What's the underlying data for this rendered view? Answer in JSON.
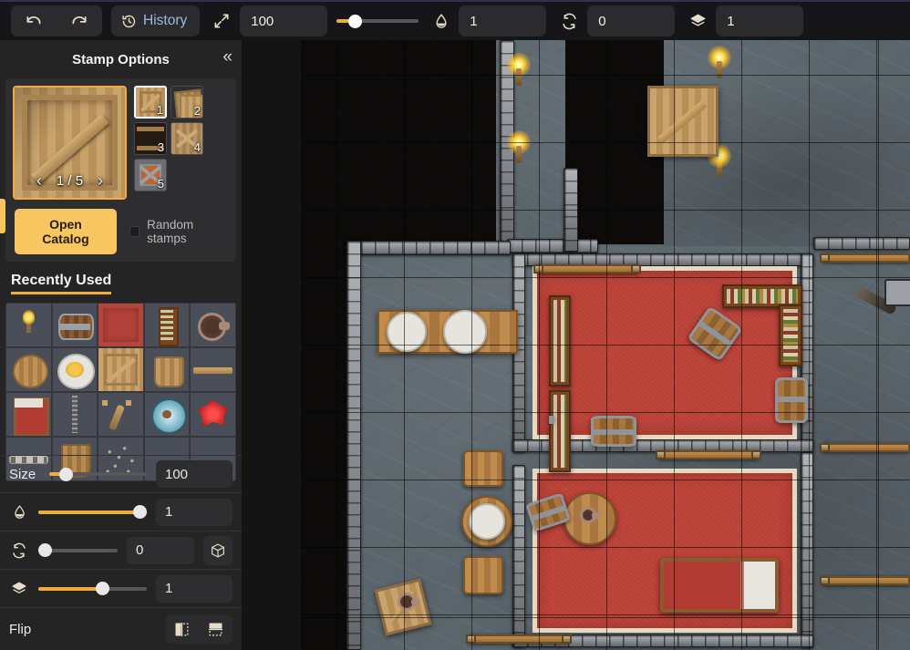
{
  "toolbar": {
    "undo": {
      "name": "undo",
      "icon": "undo-icon"
    },
    "redo": {
      "name": "redo",
      "icon": "redo-icon"
    },
    "history_label": "History",
    "size": {
      "icon": "resize-diagonal-icon",
      "value": "100",
      "slider_percent": 12
    },
    "opacity": {
      "icon": "droplet-icon",
      "value": "1"
    },
    "rotation": {
      "icon": "rotate-icon",
      "value": "0"
    },
    "layer": {
      "icon": "layers-icon",
      "value": "1"
    }
  },
  "panel": {
    "title": "Stamp Options",
    "collapse_icon": "chevron-double-left-icon",
    "stamp_preview": {
      "counter": "1 / 5",
      "prev_arrow": "‹",
      "next_arrow": "›",
      "art": "wooden-crate"
    },
    "variants": [
      {
        "num": "1",
        "art": "crate-plain",
        "selected": true
      },
      {
        "num": "2",
        "art": "crate-stacked",
        "selected": false
      },
      {
        "num": "3",
        "art": "crate-dark",
        "selected": false
      },
      {
        "num": "4",
        "art": "crate-x",
        "selected": false
      },
      {
        "num": "5",
        "art": "crate-metal",
        "selected": false
      }
    ],
    "catalog_button": "Open Catalog",
    "random_stamps": {
      "label": "Random stamps",
      "checked": false
    },
    "recently_used": {
      "heading": "Recently Used",
      "items": [
        {
          "name": "torch",
          "art": "a-torch"
        },
        {
          "name": "chest",
          "art": "a-chest"
        },
        {
          "name": "red-rug",
          "art": "a-rug"
        },
        {
          "name": "bookshelf",
          "art": "a-shelf"
        },
        {
          "name": "frying-pan",
          "art": "a-pan"
        },
        {
          "name": "barrel-top",
          "art": "a-barrel"
        },
        {
          "name": "egg-plate",
          "art": "a-plate"
        },
        {
          "name": "wooden-crate",
          "art": "a-crate",
          "selected": true
        },
        {
          "name": "bucket",
          "art": "a-bucket"
        },
        {
          "name": "wood-plank",
          "art": "a-plank"
        },
        {
          "name": "bed",
          "art": "a-bed"
        },
        {
          "name": "ladder",
          "art": "a-ladder"
        },
        {
          "name": "wand",
          "art": "a-stick"
        },
        {
          "name": "shield",
          "art": "a-shield"
        },
        {
          "name": "red-crystal",
          "art": "a-gem"
        },
        {
          "name": "stone-bench",
          "art": "a-bench"
        },
        {
          "name": "water-bucket",
          "art": "a-wbucket"
        },
        {
          "name": "rubble",
          "art": "a-rubble"
        },
        {
          "name": "empty-1",
          "art": "empty"
        },
        {
          "name": "empty-2",
          "art": "empty"
        }
      ]
    },
    "controls": [
      {
        "key": "size",
        "label": "Size",
        "icon": "",
        "value": "100",
        "percent": 13,
        "has_dice": false
      },
      {
        "key": "opacity",
        "label": "",
        "icon": "droplet-icon",
        "value": "1",
        "percent": 100,
        "has_dice": false
      },
      {
        "key": "rotation",
        "label": "",
        "icon": "rotate-icon",
        "value": "0",
        "percent": 0,
        "has_dice": true
      },
      {
        "key": "layer",
        "label": "",
        "icon": "layers-icon",
        "value": "1",
        "percent": 55,
        "has_dice": false
      }
    ],
    "flip": {
      "label": "Flip",
      "horizontal_icon": "flip-horizontal-icon",
      "vertical_icon": "flip-vertical-icon"
    },
    "edge_tab": "panel-edge-handle"
  },
  "canvas": {
    "name": "battlemap-canvas",
    "grid_size_px": 74,
    "colors": {
      "accent": "#f0ad3c",
      "catalog_button": "#f8c660",
      "panel_bg": "#242425",
      "toolbar_bg": "#161618",
      "rug_red": "#c0453b",
      "stone_floor": "#5b656c",
      "wall_stone": "#8e9399",
      "darkness": "#0d0b0a",
      "history_text": "#9bbbe0"
    }
  }
}
